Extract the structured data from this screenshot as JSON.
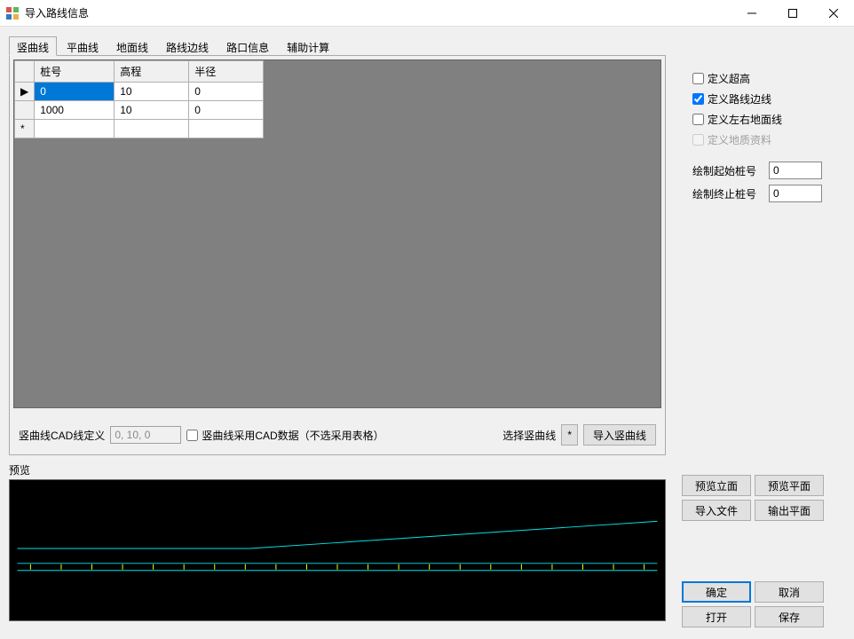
{
  "window": {
    "title": "导入路线信息"
  },
  "tabs": [
    "竖曲线",
    "平曲线",
    "地面线",
    "路线边线",
    "路口信息",
    "辅助计算"
  ],
  "grid": {
    "headers": [
      "桩号",
      "高程",
      "半径"
    ],
    "rows": [
      {
        "c0": "0",
        "c1": "10",
        "c2": "0",
        "selected": true
      },
      {
        "c0": "1000",
        "c1": "10",
        "c2": "0"
      }
    ]
  },
  "gridctrls": {
    "cadDefLabel": "竖曲线CAD线定义",
    "cadDefValue": "0, 10, 0",
    "useCadLabel": "竖曲线采用CAD数据（不选采用表格）",
    "selectLabel": "选择竖曲线",
    "starBtn": "*",
    "importBtn": "导入竖曲线"
  },
  "previewLabel": "预览",
  "rightOpts": {
    "opt1": "定义超高",
    "opt2": "定义路线边线",
    "opt3": "定义左右地面线",
    "opt4": "定义地质资料"
  },
  "params": {
    "startLabel": "绘制起始桩号",
    "startValue": "0",
    "endLabel": "绘制终止桩号",
    "endValue": "0"
  },
  "buttons": {
    "previewElev": "预览立面",
    "previewPlan": "预览平面",
    "importFile": "导入文件",
    "outputPlan": "输出平面",
    "ok": "确定",
    "cancel": "取消",
    "open": "打开",
    "save": "保存"
  }
}
